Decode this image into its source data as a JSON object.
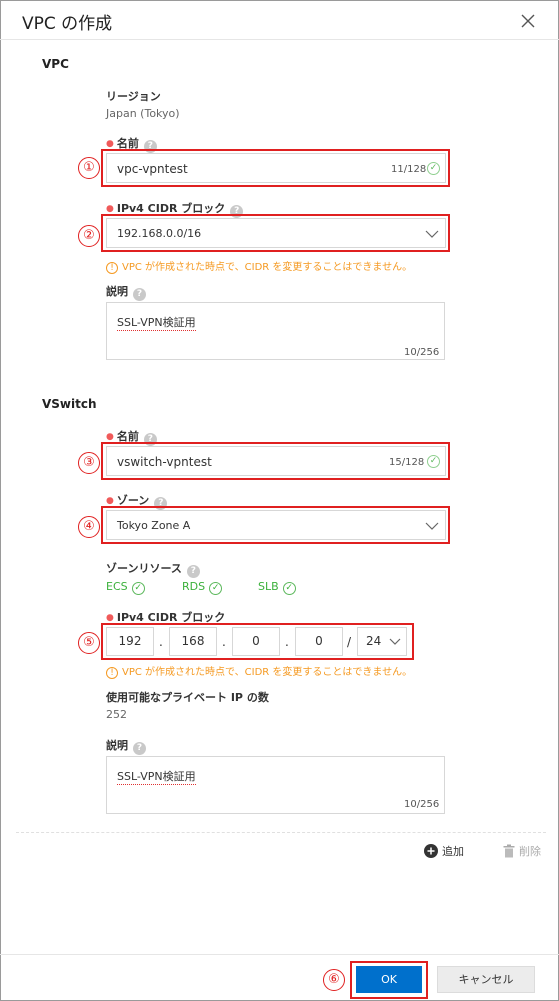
{
  "dialog": {
    "title": "VPC の作成"
  },
  "vpc": {
    "section_label": "VPC",
    "region_label": "リージョン",
    "region_value": "Japan (Tokyo)",
    "name_label": "名前",
    "name_value": "vpc-vpntest",
    "name_count": "11/128",
    "cidr_label": "IPv4 CIDR ブロック",
    "cidr_value": "192.168.0.0/16",
    "cidr_warning": "VPC が作成された時点で、CIDR を変更することはできません。",
    "desc_label": "説明",
    "desc_value": "SSL-VPN検証用",
    "desc_count": "10/256"
  },
  "vswitch": {
    "section_label": "VSwitch",
    "name_label": "名前",
    "name_value": "vswitch-vpntest",
    "name_count": "15/128",
    "zone_label": "ゾーン",
    "zone_value": "Tokyo Zone A",
    "zone_resources_label": "ゾーンリソース",
    "zone_resources": [
      "ECS",
      "RDS",
      "SLB"
    ],
    "cidr_label": "IPv4 CIDR ブロック",
    "cidr_octets": [
      "192",
      "168",
      "0",
      "0"
    ],
    "cidr_sep": ".",
    "cidr_slash": "/",
    "cidr_mask": "24",
    "cidr_warning": "VPC が作成された時点で、CIDR を変更することはできません。",
    "available_ip_label": "使用可能なプライベート IP の数",
    "available_ip_value": "252",
    "desc_label": "説明",
    "desc_value": "SSL-VPN検証用",
    "desc_count": "10/256"
  },
  "actions": {
    "add_label": "追加",
    "delete_label": "削除"
  },
  "footer": {
    "ok_label": "OK",
    "cancel_label": "キャンセル"
  },
  "annotations": [
    "①",
    "②",
    "③",
    "④",
    "⑤",
    "⑥"
  ],
  "colors": {
    "primary": "#0070cc",
    "required": "#f05a5a",
    "warning": "#f59a23",
    "success": "#3bb03b",
    "annotation": "#e02020"
  }
}
